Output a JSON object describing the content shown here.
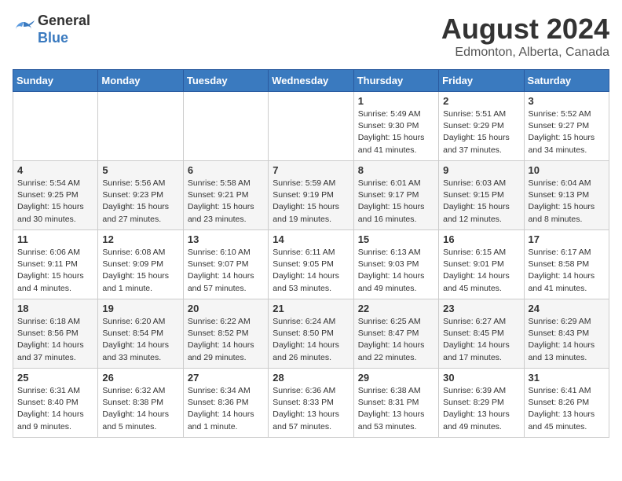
{
  "header": {
    "logo_line1": "General",
    "logo_line2": "Blue",
    "month_year": "August 2024",
    "location": "Edmonton, Alberta, Canada"
  },
  "weekdays": [
    "Sunday",
    "Monday",
    "Tuesday",
    "Wednesday",
    "Thursday",
    "Friday",
    "Saturday"
  ],
  "weeks": [
    [
      {
        "day": "",
        "info": ""
      },
      {
        "day": "",
        "info": ""
      },
      {
        "day": "",
        "info": ""
      },
      {
        "day": "",
        "info": ""
      },
      {
        "day": "1",
        "info": "Sunrise: 5:49 AM\nSunset: 9:30 PM\nDaylight: 15 hours\nand 41 minutes."
      },
      {
        "day": "2",
        "info": "Sunrise: 5:51 AM\nSunset: 9:29 PM\nDaylight: 15 hours\nand 37 minutes."
      },
      {
        "day": "3",
        "info": "Sunrise: 5:52 AM\nSunset: 9:27 PM\nDaylight: 15 hours\nand 34 minutes."
      }
    ],
    [
      {
        "day": "4",
        "info": "Sunrise: 5:54 AM\nSunset: 9:25 PM\nDaylight: 15 hours\nand 30 minutes."
      },
      {
        "day": "5",
        "info": "Sunrise: 5:56 AM\nSunset: 9:23 PM\nDaylight: 15 hours\nand 27 minutes."
      },
      {
        "day": "6",
        "info": "Sunrise: 5:58 AM\nSunset: 9:21 PM\nDaylight: 15 hours\nand 23 minutes."
      },
      {
        "day": "7",
        "info": "Sunrise: 5:59 AM\nSunset: 9:19 PM\nDaylight: 15 hours\nand 19 minutes."
      },
      {
        "day": "8",
        "info": "Sunrise: 6:01 AM\nSunset: 9:17 PM\nDaylight: 15 hours\nand 16 minutes."
      },
      {
        "day": "9",
        "info": "Sunrise: 6:03 AM\nSunset: 9:15 PM\nDaylight: 15 hours\nand 12 minutes."
      },
      {
        "day": "10",
        "info": "Sunrise: 6:04 AM\nSunset: 9:13 PM\nDaylight: 15 hours\nand 8 minutes."
      }
    ],
    [
      {
        "day": "11",
        "info": "Sunrise: 6:06 AM\nSunset: 9:11 PM\nDaylight: 15 hours\nand 4 minutes."
      },
      {
        "day": "12",
        "info": "Sunrise: 6:08 AM\nSunset: 9:09 PM\nDaylight: 15 hours\nand 1 minute."
      },
      {
        "day": "13",
        "info": "Sunrise: 6:10 AM\nSunset: 9:07 PM\nDaylight: 14 hours\nand 57 minutes."
      },
      {
        "day": "14",
        "info": "Sunrise: 6:11 AM\nSunset: 9:05 PM\nDaylight: 14 hours\nand 53 minutes."
      },
      {
        "day": "15",
        "info": "Sunrise: 6:13 AM\nSunset: 9:03 PM\nDaylight: 14 hours\nand 49 minutes."
      },
      {
        "day": "16",
        "info": "Sunrise: 6:15 AM\nSunset: 9:01 PM\nDaylight: 14 hours\nand 45 minutes."
      },
      {
        "day": "17",
        "info": "Sunrise: 6:17 AM\nSunset: 8:58 PM\nDaylight: 14 hours\nand 41 minutes."
      }
    ],
    [
      {
        "day": "18",
        "info": "Sunrise: 6:18 AM\nSunset: 8:56 PM\nDaylight: 14 hours\nand 37 minutes."
      },
      {
        "day": "19",
        "info": "Sunrise: 6:20 AM\nSunset: 8:54 PM\nDaylight: 14 hours\nand 33 minutes."
      },
      {
        "day": "20",
        "info": "Sunrise: 6:22 AM\nSunset: 8:52 PM\nDaylight: 14 hours\nand 29 minutes."
      },
      {
        "day": "21",
        "info": "Sunrise: 6:24 AM\nSunset: 8:50 PM\nDaylight: 14 hours\nand 26 minutes."
      },
      {
        "day": "22",
        "info": "Sunrise: 6:25 AM\nSunset: 8:47 PM\nDaylight: 14 hours\nand 22 minutes."
      },
      {
        "day": "23",
        "info": "Sunrise: 6:27 AM\nSunset: 8:45 PM\nDaylight: 14 hours\nand 17 minutes."
      },
      {
        "day": "24",
        "info": "Sunrise: 6:29 AM\nSunset: 8:43 PM\nDaylight: 14 hours\nand 13 minutes."
      }
    ],
    [
      {
        "day": "25",
        "info": "Sunrise: 6:31 AM\nSunset: 8:40 PM\nDaylight: 14 hours\nand 9 minutes."
      },
      {
        "day": "26",
        "info": "Sunrise: 6:32 AM\nSunset: 8:38 PM\nDaylight: 14 hours\nand 5 minutes."
      },
      {
        "day": "27",
        "info": "Sunrise: 6:34 AM\nSunset: 8:36 PM\nDaylight: 14 hours\nand 1 minute."
      },
      {
        "day": "28",
        "info": "Sunrise: 6:36 AM\nSunset: 8:33 PM\nDaylight: 13 hours\nand 57 minutes."
      },
      {
        "day": "29",
        "info": "Sunrise: 6:38 AM\nSunset: 8:31 PM\nDaylight: 13 hours\nand 53 minutes."
      },
      {
        "day": "30",
        "info": "Sunrise: 6:39 AM\nSunset: 8:29 PM\nDaylight: 13 hours\nand 49 minutes."
      },
      {
        "day": "31",
        "info": "Sunrise: 6:41 AM\nSunset: 8:26 PM\nDaylight: 13 hours\nand 45 minutes."
      }
    ]
  ]
}
